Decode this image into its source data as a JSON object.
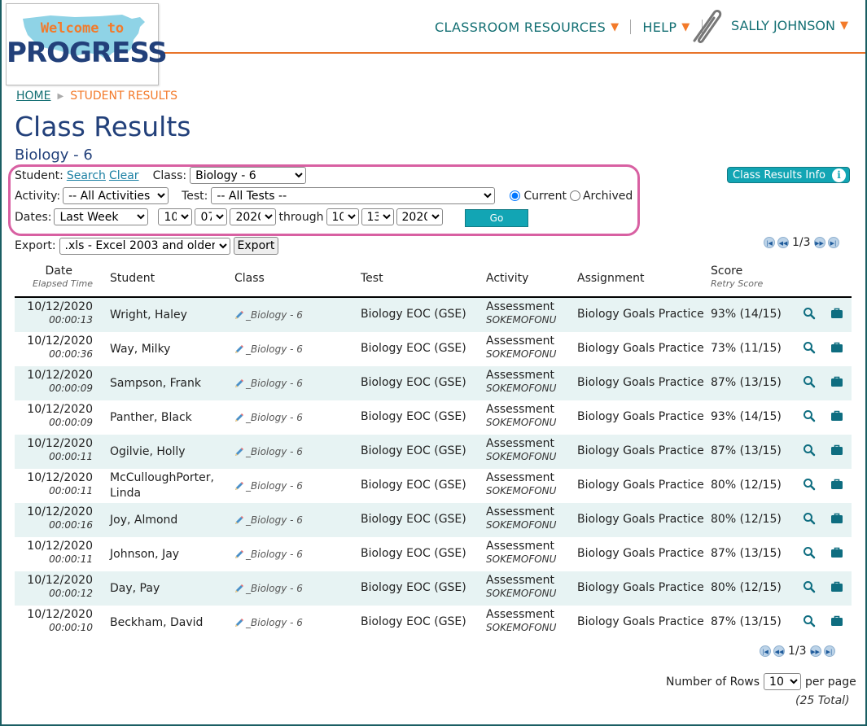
{
  "logo": {
    "welcome": "Welcome to",
    "progress": "PROGRESS",
    "map_icon": "usa-map-icon"
  },
  "nav": {
    "resources": "CLASSROOM RESOURCES",
    "help": "HELP",
    "user": "SALLY JOHNSON",
    "arrow": "▼",
    "clip_icon": "paperclip-icon"
  },
  "colors": {
    "teal": "#136f73",
    "orange": "#f37a2a",
    "navy": "#22407a",
    "button": "#12a5b4",
    "highlight": "#d860a2",
    "row_alt": "#e7f3f3"
  },
  "breadcrumb": {
    "home": "HOME",
    "current": "STUDENT RESULTS"
  },
  "page": {
    "title": "Class Results",
    "subtitle": "Biology - 6"
  },
  "filters": {
    "student_label": "Student:",
    "search": "Search",
    "clear": "Clear",
    "class_label": "Class:",
    "class_value": "Biology - 6",
    "activity_label": "Activity:",
    "activity_value": "-- All Activities --",
    "test_label": "Test:",
    "test_value": "-- All Tests --",
    "current": "Current",
    "archived": "Archived",
    "dates_label": "Dates:",
    "dates_value": "Last Week",
    "from_month": "10",
    "from_day": "07",
    "from_year": "2020",
    "through": "through",
    "to_month": "10",
    "to_day": "13",
    "to_year": "2020",
    "go": "Go"
  },
  "info_button": "Class Results Info",
  "export": {
    "label": "Export:",
    "format": ".xls - Excel 2003 and older",
    "button": "Export"
  },
  "pager": {
    "text": "1/3"
  },
  "table": {
    "headers": {
      "date": "Date",
      "date_sub": "Elapsed Time",
      "student": "Student",
      "class": "Class",
      "test": "Test",
      "activity": "Activity",
      "assignment": "Assignment",
      "score": "Score",
      "score_sub": "Retry Score"
    },
    "rows": [
      {
        "date": "10/12/2020",
        "time": "00:00:13",
        "student": "Wright, Haley",
        "class": "_Biology - 6",
        "test": "Biology EOC (GSE)",
        "activity": "Assessment",
        "code": "SOKEMOFONU",
        "assignment": "Biology Goals Practice",
        "score": "93% (14/15)"
      },
      {
        "date": "10/12/2020",
        "time": "00:00:36",
        "student": "Way, Milky",
        "class": "_Biology - 6",
        "test": "Biology EOC (GSE)",
        "activity": "Assessment",
        "code": "SOKEMOFONU",
        "assignment": "Biology Goals Practice",
        "score": "73% (11/15)"
      },
      {
        "date": "10/12/2020",
        "time": "00:00:09",
        "student": "Sampson, Frank",
        "class": "_Biology - 6",
        "test": "Biology EOC (GSE)",
        "activity": "Assessment",
        "code": "SOKEMOFONU",
        "assignment": "Biology Goals Practice",
        "score": "87% (13/15)"
      },
      {
        "date": "10/12/2020",
        "time": "00:00:09",
        "student": "Panther, Black",
        "class": "_Biology - 6",
        "test": "Biology EOC (GSE)",
        "activity": "Assessment",
        "code": "SOKEMOFONU",
        "assignment": "Biology Goals Practice",
        "score": "93% (14/15)"
      },
      {
        "date": "10/12/2020",
        "time": "00:00:11",
        "student": "Ogilvie, Holly",
        "class": "_Biology - 6",
        "test": "Biology EOC (GSE)",
        "activity": "Assessment",
        "code": "SOKEMOFONU",
        "assignment": "Biology Goals Practice",
        "score": "87% (13/15)"
      },
      {
        "date": "10/12/2020",
        "time": "00:00:11",
        "student": "McCulloughPorter, Linda",
        "class": "_Biology - 6",
        "test": "Biology EOC (GSE)",
        "activity": "Assessment",
        "code": "SOKEMOFONU",
        "assignment": "Biology Goals Practice",
        "score": "80% (12/15)"
      },
      {
        "date": "10/12/2020",
        "time": "00:00:16",
        "student": "Joy, Almond",
        "class": "_Biology - 6",
        "test": "Biology EOC (GSE)",
        "activity": "Assessment",
        "code": "SOKEMOFONU",
        "assignment": "Biology Goals Practice",
        "score": "80% (12/15)"
      },
      {
        "date": "10/12/2020",
        "time": "00:00:11",
        "student": "Johnson, Jay",
        "class": "_Biology - 6",
        "test": "Biology EOC (GSE)",
        "activity": "Assessment",
        "code": "SOKEMOFONU",
        "assignment": "Biology Goals Practice",
        "score": "87% (13/15)"
      },
      {
        "date": "10/12/2020",
        "time": "00:00:12",
        "student": "Day, Pay",
        "class": "_Biology - 6",
        "test": "Biology EOC (GSE)",
        "activity": "Assessment",
        "code": "SOKEMOFONU",
        "assignment": "Biology Goals Practice",
        "score": "80% (12/15)"
      },
      {
        "date": "10/12/2020",
        "time": "00:00:10",
        "student": "Beckham, David",
        "class": "_Biology - 6",
        "test": "Biology EOC (GSE)",
        "activity": "Assessment",
        "code": "SOKEMOFONU",
        "assignment": "Biology Goals Practice",
        "score": "87% (13/15)"
      }
    ]
  },
  "footer": {
    "rows_label": "Number of Rows",
    "rows_value": "10",
    "per_page": "per page",
    "total": "(25 Total)"
  }
}
